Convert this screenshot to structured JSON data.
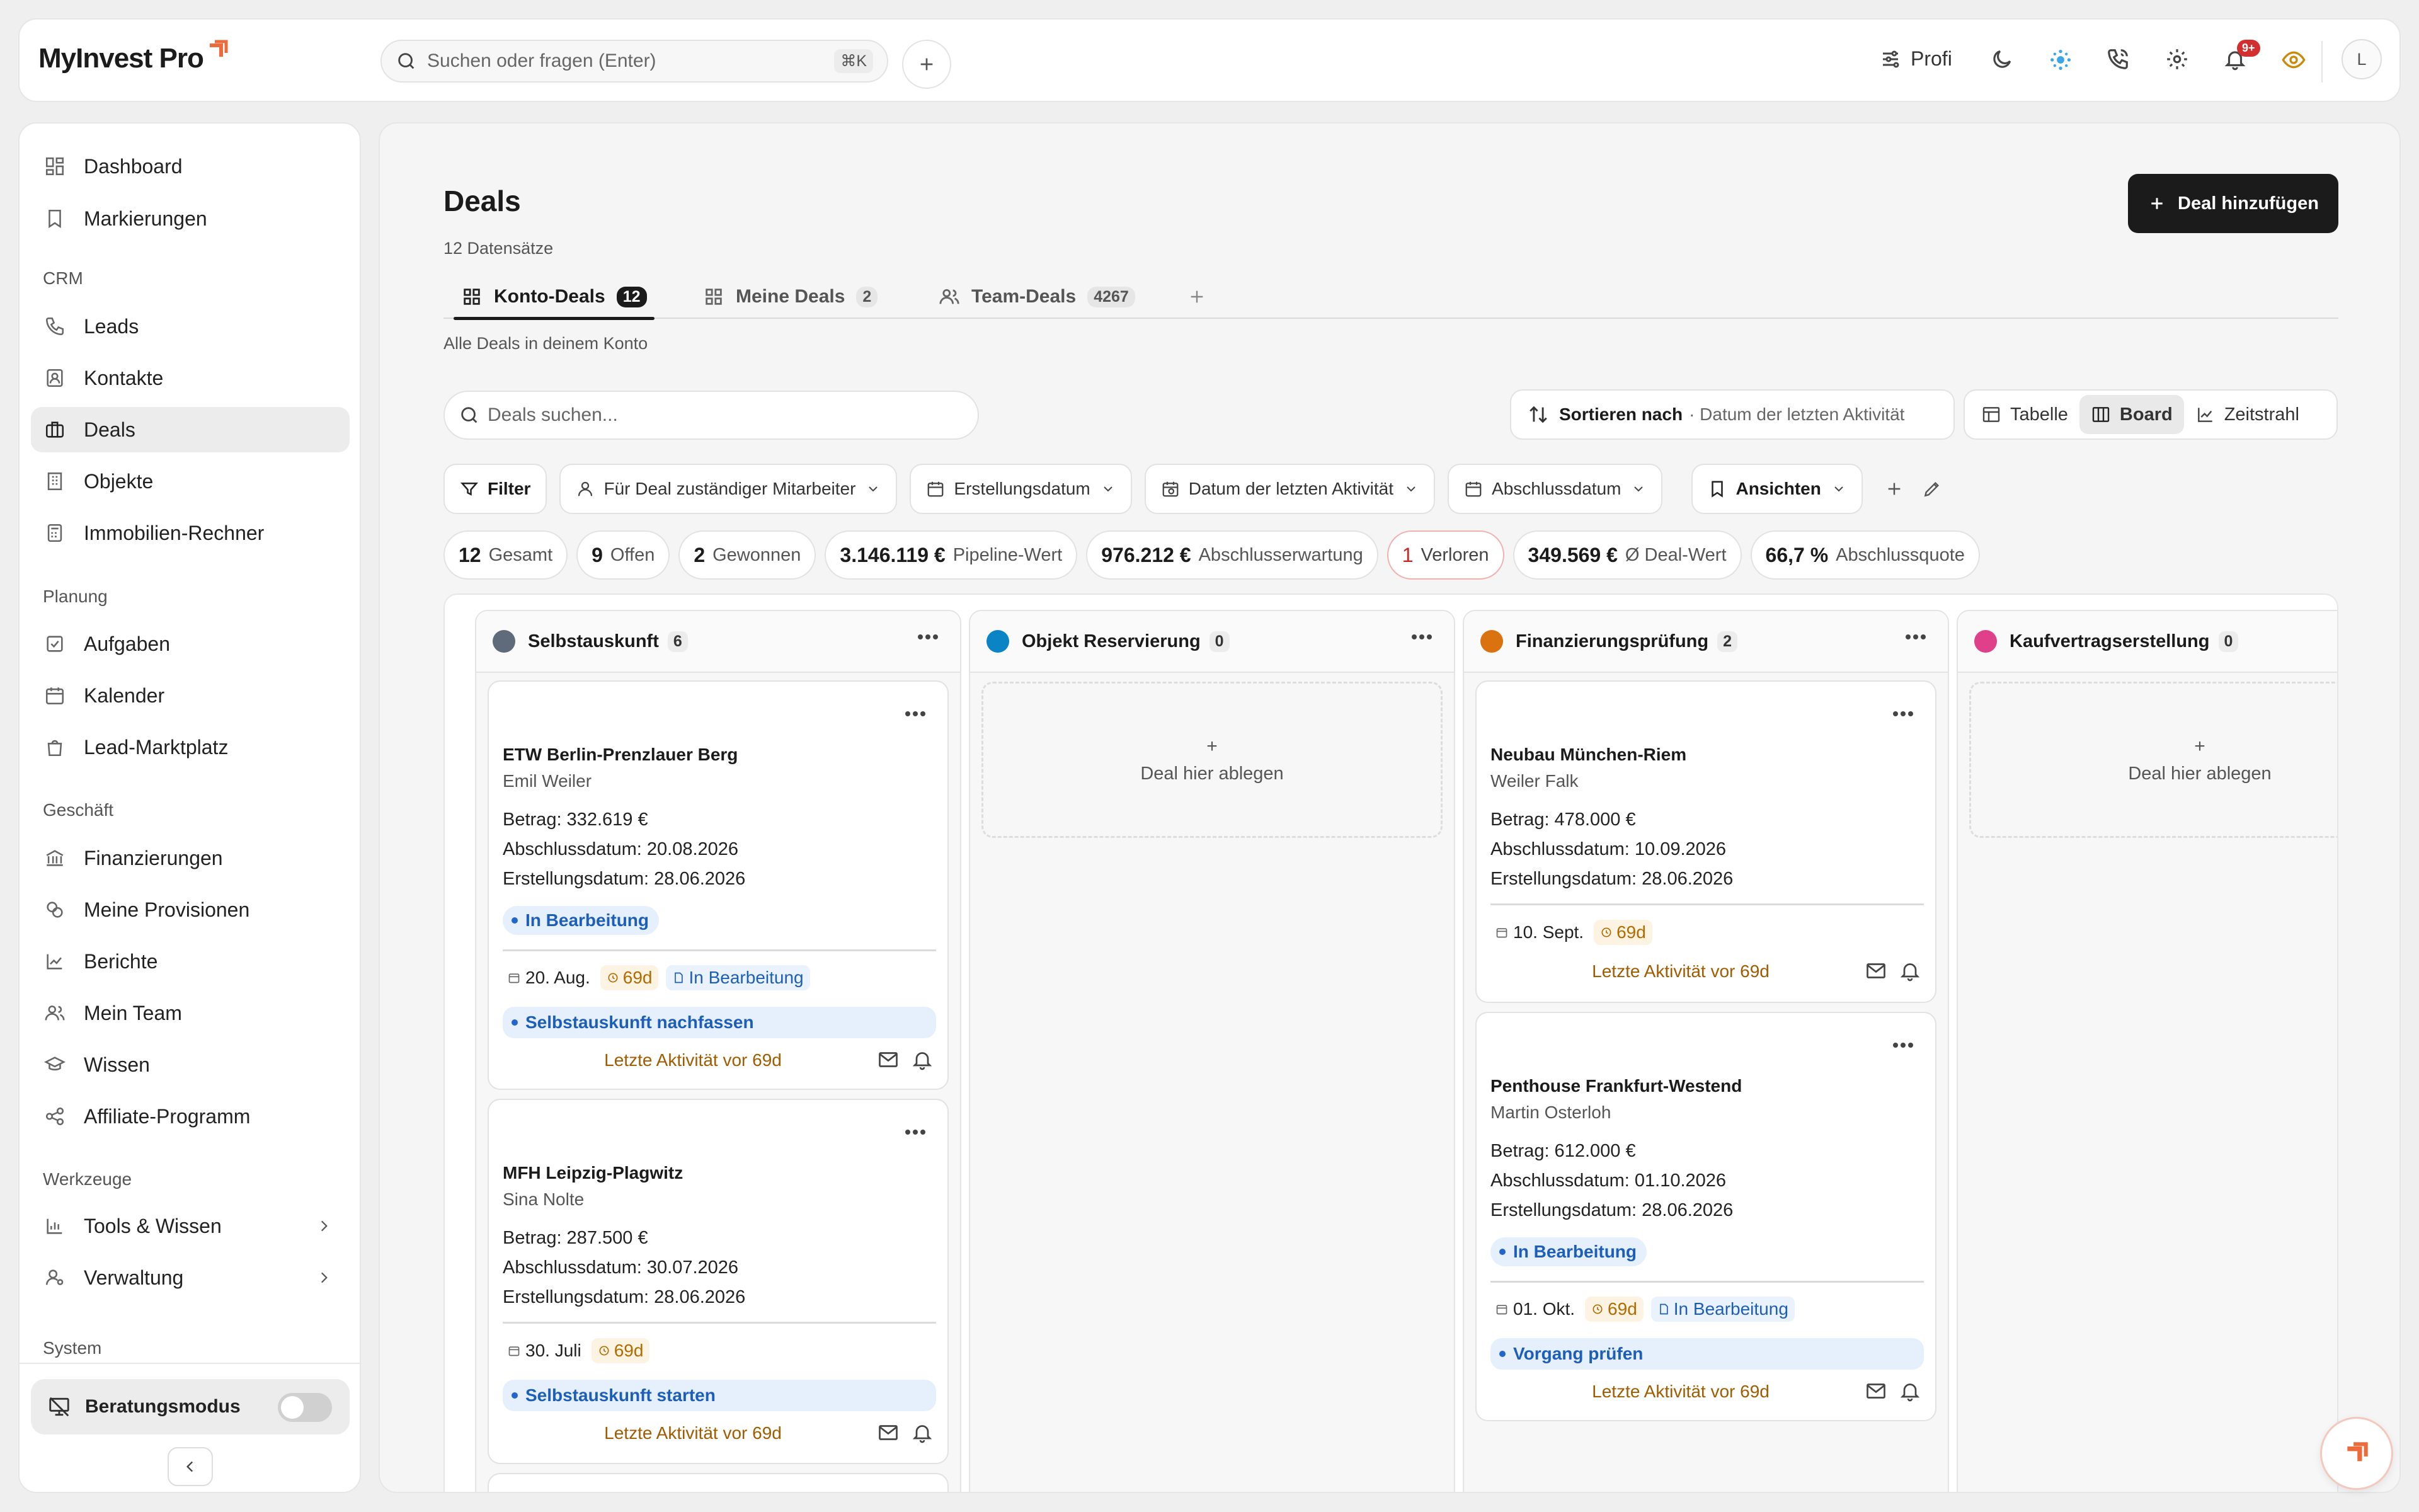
{
  "app": {
    "logo_text": "MyInvest Pro"
  },
  "header": {
    "search_placeholder": "Suchen oder fragen (Enter)",
    "search_shortcut": "⌘K",
    "profi_label": "Profi",
    "notification_badge": "9+",
    "avatar_initial": "L"
  },
  "sidebar": {
    "top_items": [
      {
        "label": "Dashboard",
        "icon": "dashboard-icon"
      },
      {
        "label": "Markierungen",
        "icon": "bookmark-icon"
      }
    ],
    "sections": [
      {
        "heading": "CRM",
        "items": [
          {
            "label": "Leads",
            "icon": "phone-icon"
          },
          {
            "label": "Kontakte",
            "icon": "contact-icon"
          },
          {
            "label": "Deals",
            "icon": "briefcase-icon",
            "active": true
          },
          {
            "label": "Objekte",
            "icon": "building-icon"
          },
          {
            "label": "Immobilien-Rechner",
            "icon": "calculator-icon"
          }
        ]
      },
      {
        "heading": "Planung",
        "items": [
          {
            "label": "Aufgaben",
            "icon": "checkbox-icon"
          },
          {
            "label": "Kalender",
            "icon": "calendar-icon"
          },
          {
            "label": "Lead-Marktplatz",
            "icon": "shopping-bag-icon"
          }
        ]
      },
      {
        "heading": "Geschäft",
        "items": [
          {
            "label": "Finanzierungen",
            "icon": "bank-icon"
          },
          {
            "label": "Meine Provisionen",
            "icon": "coins-icon"
          },
          {
            "label": "Berichte",
            "icon": "chart-line-icon"
          },
          {
            "label": "Mein Team",
            "icon": "users-icon"
          },
          {
            "label": "Wissen",
            "icon": "graduation-cap-icon"
          },
          {
            "label": "Affiliate-Programm",
            "icon": "share-icon"
          }
        ]
      },
      {
        "heading": "Werkzeuge",
        "items": [
          {
            "label": "Tools & Wissen",
            "icon": "bar-chart-icon"
          },
          {
            "label": "Verwaltung",
            "icon": "user-cog-icon"
          }
        ]
      },
      {
        "heading": "System",
        "items": []
      }
    ],
    "consult_mode_label": "Beratungsmodus",
    "consult_mode_on": false
  },
  "page": {
    "title": "Deals",
    "record_count": "12 Datensätze",
    "add_button": "Deal hinzufügen",
    "tabs": [
      {
        "label": "Konto-Deals",
        "count": "12",
        "active": true
      },
      {
        "label": "Meine Deals",
        "count": "2"
      },
      {
        "label": "Team-Deals",
        "count": "4267"
      }
    ],
    "tab_description": "Alle Deals in deinem Konto",
    "search_placeholder": "Deals suchen...",
    "sort_label": "Sortieren nach",
    "sort_value": "· Datum der letzten Aktivität",
    "views": [
      {
        "label": "Tabelle"
      },
      {
        "label": "Board",
        "active": true
      },
      {
        "label": "Zeitstrahl"
      }
    ],
    "filters": [
      "Filter",
      "Für Deal zuständiger Mitarbeiter",
      "Erstellungsdatum",
      "Datum der letzten Aktivität",
      "Abschlussdatum",
      "Ansichten"
    ],
    "stats": [
      {
        "value": "12",
        "label": "Gesamt"
      },
      {
        "value": "9",
        "label": "Offen"
      },
      {
        "value": "2",
        "label": "Gewonnen"
      },
      {
        "value": "3.146.119 €",
        "label": "Pipeline-Wert"
      },
      {
        "value": "976.212 €",
        "label": "Abschlusserwartung"
      },
      {
        "value": "1",
        "label": "Verloren"
      },
      {
        "value": "349.569 €",
        "label": "Ø Deal-Wert"
      },
      {
        "value": "66,7 %",
        "label": "Abschlussquote"
      }
    ]
  },
  "board": {
    "drop_label": "Deal hier ablegen",
    "drop_plus": "+",
    "columns": [
      {
        "name": "Selbstauskunft",
        "count": "6",
        "color": "#5f6b7a",
        "cards": [
          {
            "title": "ETW Berlin-Prenzlauer Berg",
            "person": "Emil Weiler",
            "amount": "Betrag: 332.619 €",
            "close_date": "Abschlussdatum: 20.08.2026",
            "created": "Erstellungsdatum: 28.06.2026",
            "status": "In Bearbeitung",
            "meta_date": "20. Aug.",
            "meta_age": "69d",
            "meta_status": "In Bearbeitung",
            "task": "Selbstauskunft nachfassen",
            "activity": "Letzte Aktivität vor 69d"
          },
          {
            "title": "MFH Leipzig-Plagwitz",
            "person": "Sina Nolte",
            "amount": "Betrag: 287.500 €",
            "close_date": "Abschlussdatum: 30.07.2026",
            "created": "Erstellungsdatum: 28.06.2026",
            "meta_date": "30. Juli",
            "meta_age": "69d",
            "task": "Selbstauskunft starten",
            "activity": "Letzte Aktivität vor 69d"
          }
        ]
      },
      {
        "name": "Objekt Reservierung",
        "count": "0",
        "color": "#0b84c6",
        "cards": []
      },
      {
        "name": "Finanzierungsprüfung",
        "count": "2",
        "color": "#d9720f",
        "cards": [
          {
            "title": "Neubau München-Riem",
            "person": "Weiler Falk",
            "amount": "Betrag: 478.000 €",
            "close_date": "Abschlussdatum: 10.09.2026",
            "created": "Erstellungsdatum: 28.06.2026",
            "meta_date": "10. Sept.",
            "meta_age": "69d",
            "activity": "Letzte Aktivität vor 69d"
          },
          {
            "title": "Penthouse Frankfurt-Westend",
            "person": "Martin Osterloh",
            "amount": "Betrag: 612.000 €",
            "close_date": "Abschlussdatum: 01.10.2026",
            "created": "Erstellungsdatum: 28.06.2026",
            "status": "In Bearbeitung",
            "meta_date": "01. Okt.",
            "meta_age": "69d",
            "meta_status": "In Bearbeitung",
            "task": "Vorgang prüfen",
            "activity": "Letzte Aktivität vor 69d"
          }
        ]
      },
      {
        "name": "Kaufvertragserstellung",
        "count": "0",
        "color": "#e0408a",
        "cards": []
      }
    ]
  }
}
